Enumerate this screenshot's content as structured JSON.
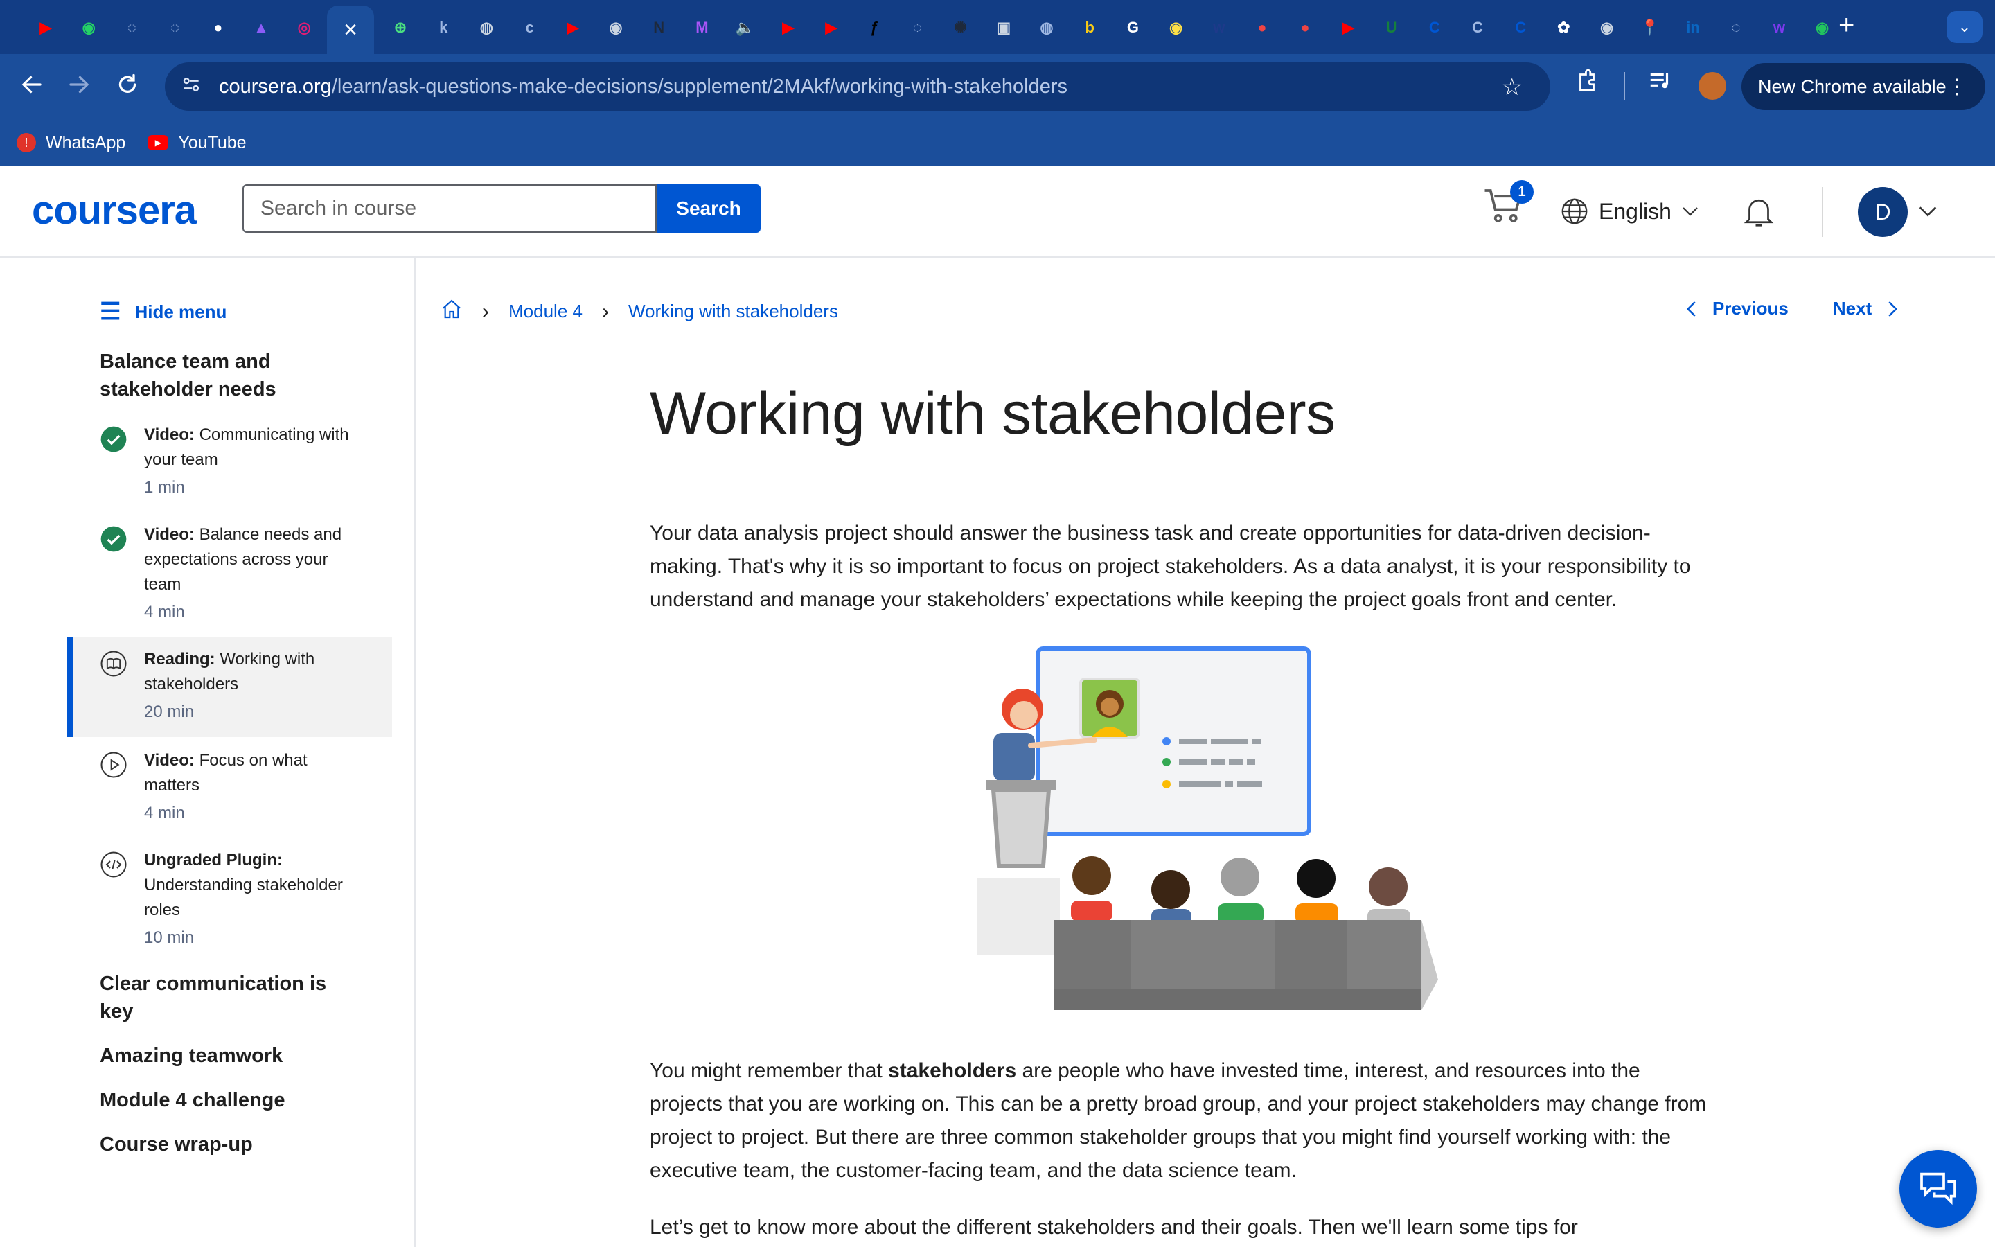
{
  "browser": {
    "active_tab_close": "×",
    "new_tab": "+",
    "tablist": "⌄",
    "url_host": "coursera.org",
    "url_path": "/learn/ask-questions-make-decisions/supplement/2MAkf/working-with-stakeholders",
    "update_label": "New Chrome available",
    "bookmarks": [
      {
        "label": "WhatsApp",
        "icon": "whatsapp-icon",
        "color": "#e0332a"
      },
      {
        "label": "YouTube",
        "icon": "youtube-icon",
        "color": "#ff0000"
      }
    ],
    "tab_icons": [
      {
        "icon": "youtube-icon",
        "color": "#ff0000",
        "glyph": "▶"
      },
      {
        "icon": "whatsapp-icon",
        "color": "#25d366",
        "glyph": "◉"
      },
      {
        "icon": "spinner-icon",
        "color": "#9fb8e3",
        "glyph": "◌"
      },
      {
        "icon": "spinner-icon",
        "color": "#9fb8e3",
        "glyph": "◌"
      },
      {
        "icon": "github-icon",
        "color": "#ffffff",
        "glyph": "●"
      },
      {
        "icon": "app-icon",
        "color": "#8b5cf6",
        "glyph": "▲"
      },
      {
        "icon": "app-icon",
        "color": "#e11d74",
        "glyph": "◎"
      }
    ],
    "tab_icons_right": [
      {
        "icon": "plus-app-icon",
        "color": "#4ade80",
        "glyph": "⊕"
      },
      {
        "icon": "k-app-icon",
        "color": "#9fb8e3",
        "glyph": "k"
      },
      {
        "icon": "globe-icon",
        "color": "#cbd5e1",
        "glyph": "◍"
      },
      {
        "icon": "c-app-icon",
        "color": "#9fb8e3",
        "glyph": "c"
      },
      {
        "icon": "youtube-icon",
        "color": "#ff0000",
        "glyph": "▶"
      },
      {
        "icon": "app-icon",
        "color": "#cbd5e1",
        "glyph": "◉"
      },
      {
        "icon": "app-icon",
        "color": "#1e293b",
        "glyph": "N"
      },
      {
        "icon": "m-app-icon",
        "color": "#a855f7",
        "glyph": "M"
      },
      {
        "icon": "speaker-icon",
        "color": "#ffffff",
        "glyph": "🔈"
      },
      {
        "icon": "youtube-icon",
        "color": "#ff0000",
        "glyph": "▶"
      },
      {
        "icon": "youtube-icon",
        "color": "#ff0000",
        "glyph": "▶"
      },
      {
        "icon": "app-icon",
        "color": "#000000",
        "glyph": "ƒ"
      },
      {
        "icon": "spinner-icon",
        "color": "#9fb8e3",
        "glyph": "◌"
      },
      {
        "icon": "app-icon",
        "color": "#1e293b",
        "glyph": "✺"
      },
      {
        "icon": "video-icon",
        "color": "#cbd5e1",
        "glyph": "▣"
      },
      {
        "icon": "app-icon",
        "color": "#9fb8e3",
        "glyph": "◍"
      },
      {
        "icon": "b-app-icon",
        "color": "#facc15",
        "glyph": "b"
      },
      {
        "icon": "google-icon",
        "color": "#ffffff",
        "glyph": "G"
      },
      {
        "icon": "app-icon",
        "color": "#fde047",
        "glyph": "◉"
      },
      {
        "icon": "app-icon",
        "color": "#1e3a8a",
        "glyph": "w"
      },
      {
        "icon": "app-icon",
        "color": "#ef4444",
        "glyph": "●"
      },
      {
        "icon": "app-icon",
        "color": "#ef4444",
        "glyph": "●"
      },
      {
        "icon": "youtube-icon",
        "color": "#ff0000",
        "glyph": "▶"
      },
      {
        "icon": "my-unt-icon",
        "color": "#15803d",
        "glyph": "U"
      },
      {
        "icon": "coursera-icon",
        "color": "#0056d2",
        "glyph": "C"
      },
      {
        "icon": "coursera-icon",
        "color": "#9fb8e3",
        "glyph": "C"
      },
      {
        "icon": "coursera-icon",
        "color": "#0056d2",
        "glyph": "C"
      },
      {
        "icon": "openai-icon",
        "color": "#ffffff",
        "glyph": "✿"
      },
      {
        "icon": "app-icon",
        "color": "#cbd5e1",
        "glyph": "◉"
      },
      {
        "icon": "maps-icon",
        "color": "#60a5fa",
        "glyph": "📍"
      },
      {
        "icon": "linkedin-icon",
        "color": "#0a66c2",
        "glyph": "in"
      },
      {
        "icon": "spinner-icon",
        "color": "#9fb8e3",
        "glyph": "◌"
      },
      {
        "icon": "app-icon",
        "color": "#7c3aed",
        "glyph": "w"
      },
      {
        "icon": "app-icon",
        "color": "#22c55e",
        "glyph": "◉"
      }
    ]
  },
  "header": {
    "logo": "coursera",
    "search_placeholder": "Search in course",
    "search_button": "Search",
    "cart_count": "1",
    "language": "English",
    "avatar_initial": "D"
  },
  "sidebar": {
    "hide_menu": "Hide menu",
    "lesson_title": "Balance team and stakeholder needs",
    "items": [
      {
        "kind": "Video:",
        "title": " Communicating with your team",
        "duration": "1 min",
        "status": "completed"
      },
      {
        "kind": "Video:",
        "title": " Balance needs and expectations across your team",
        "duration": "4 min",
        "status": "completed"
      },
      {
        "kind": "Reading:",
        "title": " Working with stakeholders",
        "duration": "20 min",
        "status": "current"
      },
      {
        "kind": "Video:",
        "title": " Focus on what matters",
        "duration": "4 min",
        "status": "todo"
      },
      {
        "kind": "Ungraded Plugin:",
        "title": " Understanding stakeholder roles",
        "duration": "10 min",
        "status": "todo"
      }
    ],
    "sections": [
      "Clear communication is key",
      "Amazing teamwork",
      "Module 4 challenge",
      "Course wrap-up"
    ]
  },
  "main": {
    "breadcrumb": [
      "Module 4",
      "Working with stakeholders"
    ],
    "previous": "Previous",
    "next": "Next",
    "title": "Working with stakeholders",
    "para1": "Your data analysis project should answer the business task and create opportunities for data-driven decision-making. That's why it is so important to focus on project stakeholders. As a data analyst, it is your responsibility to understand and manage your stakeholders’ expectations while keeping the project goals front and center.",
    "para2_before": "You might remember that ",
    "para2_bold": "stakeholders",
    "para2_after": " are people who have invested time, interest, and resources into the projects that you are  working on. This can be a pretty broad group, and your project stakeholders may change from project to project. But there are three common stakeholder groups that you might find yourself working with: the executive team, the customer-facing team, and the data science team.",
    "para3": "Let’s get to know more about the different stakeholders and their goals. Then we'll learn some tips for"
  },
  "colors": {
    "accent": "#0056d2",
    "completed": "#1f8354",
    "chrome": "#1b4e9b"
  }
}
